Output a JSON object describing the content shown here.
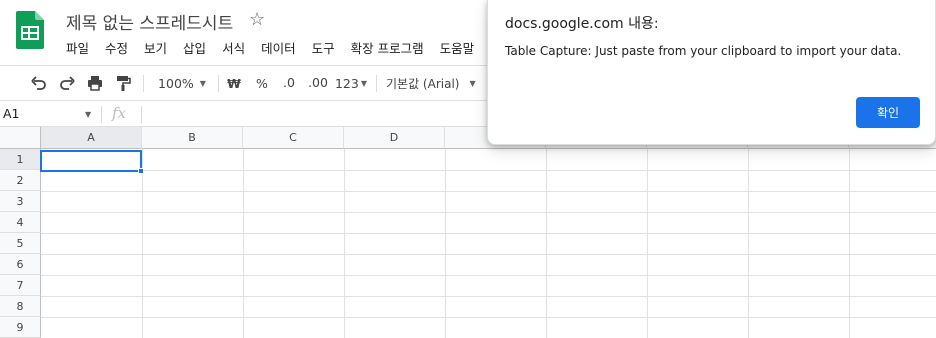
{
  "app": {
    "doc_title": "제목 없는 스프레드시트",
    "menu": [
      "파일",
      "수정",
      "보기",
      "삽입",
      "서식",
      "데이터",
      "도구",
      "확장 프로그램",
      "도움말"
    ]
  },
  "toolbar": {
    "zoom": "100%",
    "currency": "₩",
    "percent": "%",
    "decrease_decimal": ".0",
    "increase_decimal": ".00",
    "more_formats": "123",
    "font": "기본값 (Arial)"
  },
  "formula_bar": {
    "name_box": "A1",
    "fx_label": "fx"
  },
  "grid": {
    "columns": [
      "A",
      "B",
      "C",
      "D",
      "",
      "",
      "",
      "",
      ""
    ],
    "rows": [
      "1",
      "2",
      "3",
      "4",
      "5",
      "6",
      "7",
      "8",
      "9"
    ]
  },
  "dialog": {
    "title": "docs.google.com 내용:",
    "message": "Table Capture: Just paste from your clipboard to import your data.",
    "ok_label": "확인"
  },
  "colors": {
    "accent": "#1a73e8",
    "sheets_green": "#0f9d58"
  }
}
